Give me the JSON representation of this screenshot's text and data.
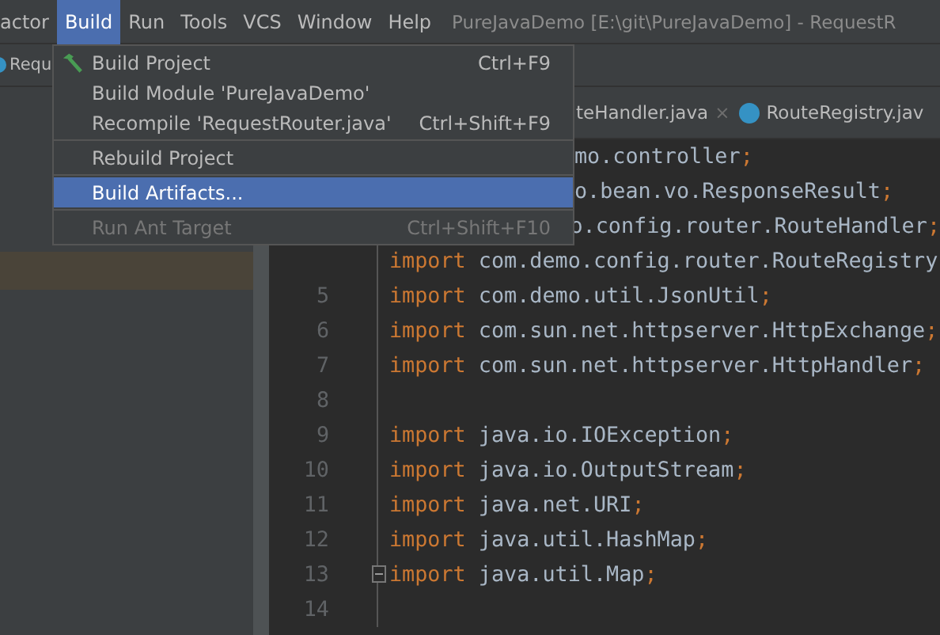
{
  "menu_bar": {
    "items": [
      {
        "label": "actor",
        "selected": false
      },
      {
        "label": "Build",
        "selected": true
      },
      {
        "label": "Run",
        "selected": false
      },
      {
        "label": "Tools",
        "selected": false
      },
      {
        "label": "VCS",
        "selected": false
      },
      {
        "label": "Window",
        "selected": false
      },
      {
        "label": "Help",
        "selected": false
      }
    ],
    "window_title": "PureJavaDemo [E:\\git\\PureJavaDemo] - RequestR"
  },
  "nav_bar": {
    "label": "Requ"
  },
  "editor_tabs": [
    {
      "label": "teHandler.java",
      "close": "×",
      "icon": false
    },
    {
      "label": "RouteRegistry.jav",
      "icon": true
    }
  ],
  "build_menu": [
    {
      "kind": "item",
      "label": "Build Project",
      "shortcut": "Ctrl+F9",
      "icon": true,
      "selected": false,
      "disabled": false
    },
    {
      "kind": "item",
      "label": "Build Module 'PureJavaDemo'",
      "selected": false,
      "disabled": false
    },
    {
      "kind": "item",
      "label": "Recompile 'RequestRouter.java'",
      "shortcut": "Ctrl+Shift+F9",
      "selected": false,
      "disabled": false
    },
    {
      "kind": "separator"
    },
    {
      "kind": "item",
      "label": "Rebuild Project",
      "selected": false,
      "disabled": false
    },
    {
      "kind": "separator"
    },
    {
      "kind": "item",
      "label": "Build Artifacts...",
      "selected": true,
      "disabled": false
    },
    {
      "kind": "separator"
    },
    {
      "kind": "item",
      "label": "Run Ant Target",
      "shortcut": "Ctrl+Shift+F10",
      "selected": false,
      "disabled": true
    }
  ],
  "code": [
    {
      "kind": "covered",
      "tokens": [
        {
          "kind": "plain",
          "text": "mo.controller"
        },
        {
          "kind": "punct",
          "text": ";"
        }
      ]
    },
    {
      "kind": "covered",
      "tokens": [
        {
          "kind": "plain",
          "text": "o.bean.vo.ResponseResult"
        },
        {
          "kind": "punct",
          "text": ";"
        }
      ]
    },
    {
      "kind": "covered",
      "tokens": [
        {
          "kind": "plain",
          "text": "o.config.router.RouteHandler"
        },
        {
          "kind": "punct",
          "text": ";"
        }
      ]
    },
    {
      "kind": "normal",
      "tokens": [
        {
          "kind": "keyword",
          "text": "import"
        },
        {
          "kind": "plain",
          "text": " com.demo.config.router.RouteRegistry"
        }
      ]
    },
    {
      "number": "5",
      "kind": "normal",
      "tokens": [
        {
          "kind": "keyword",
          "text": "import"
        },
        {
          "kind": "plain",
          "text": " com.demo.util.JsonUtil"
        },
        {
          "kind": "punct",
          "text": ";"
        }
      ]
    },
    {
      "number": "6",
      "kind": "normal",
      "tokens": [
        {
          "kind": "keyword",
          "text": "import"
        },
        {
          "kind": "plain",
          "text": " com.sun.net.httpserver.HttpExchange"
        },
        {
          "kind": "punct",
          "text": ";"
        }
      ]
    },
    {
      "number": "7",
      "kind": "normal",
      "tokens": [
        {
          "kind": "keyword",
          "text": "import"
        },
        {
          "kind": "plain",
          "text": " com.sun.net.httpserver.HttpHandler"
        },
        {
          "kind": "punct",
          "text": ";"
        }
      ]
    },
    {
      "number": "8"
    },
    {
      "number": "9",
      "kind": "normal",
      "tokens": [
        {
          "kind": "keyword",
          "text": "import"
        },
        {
          "kind": "plain",
          "text": " java.io.IOException"
        },
        {
          "kind": "punct",
          "text": ";"
        }
      ]
    },
    {
      "number": "10",
      "kind": "normal",
      "tokens": [
        {
          "kind": "keyword",
          "text": "import"
        },
        {
          "kind": "plain",
          "text": " java.io.OutputStream"
        },
        {
          "kind": "punct",
          "text": ";"
        }
      ]
    },
    {
      "number": "11",
      "kind": "normal",
      "tokens": [
        {
          "kind": "keyword",
          "text": "import"
        },
        {
          "kind": "plain",
          "text": " java.net.URI"
        },
        {
          "kind": "punct",
          "text": ";"
        }
      ]
    },
    {
      "number": "12",
      "kind": "normal",
      "tokens": [
        {
          "kind": "keyword",
          "text": "import"
        },
        {
          "kind": "plain",
          "text": " java.util.HashMap"
        },
        {
          "kind": "punct",
          "text": ";"
        }
      ]
    },
    {
      "number": "13",
      "kind": "normal",
      "fold": true,
      "tokens": [
        {
          "kind": "keyword",
          "text": "import"
        },
        {
          "kind": "plain",
          "text": " java.util.Map"
        },
        {
          "kind": "punct",
          "text": ";"
        }
      ]
    },
    {
      "number": "14"
    }
  ]
}
